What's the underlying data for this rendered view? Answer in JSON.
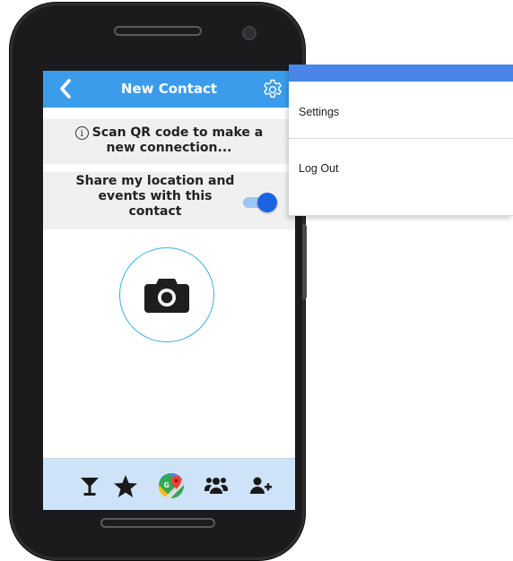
{
  "screen": {
    "title": "New Contact",
    "back_icon": "chevron-left-icon",
    "settings_icon": "gear-icon",
    "scan_info": {
      "icon": "info-icon",
      "icon_glyph": "i",
      "line1": "Scan QR code to make a",
      "line2": "new connection..."
    },
    "share_location": {
      "label": "Share my location and events with this contact",
      "enabled": true
    },
    "camera_button_icon": "camera-icon"
  },
  "bottom_nav": [
    {
      "icon": "cocktail-icon"
    },
    {
      "icon": "star-icon"
    },
    {
      "icon": "maps-icon"
    },
    {
      "icon": "group-icon"
    },
    {
      "icon": "add-user-icon"
    }
  ],
  "menu": {
    "items": [
      {
        "label": "Settings"
      },
      {
        "label": "Log Out"
      }
    ]
  },
  "colors": {
    "app_bar": "#3b9cec",
    "menu_bar": "#4a86e8",
    "bottom_nav": "#cfe3f8",
    "toggle_on": "#1a64e0",
    "camera_ring": "#3ab0e8"
  }
}
